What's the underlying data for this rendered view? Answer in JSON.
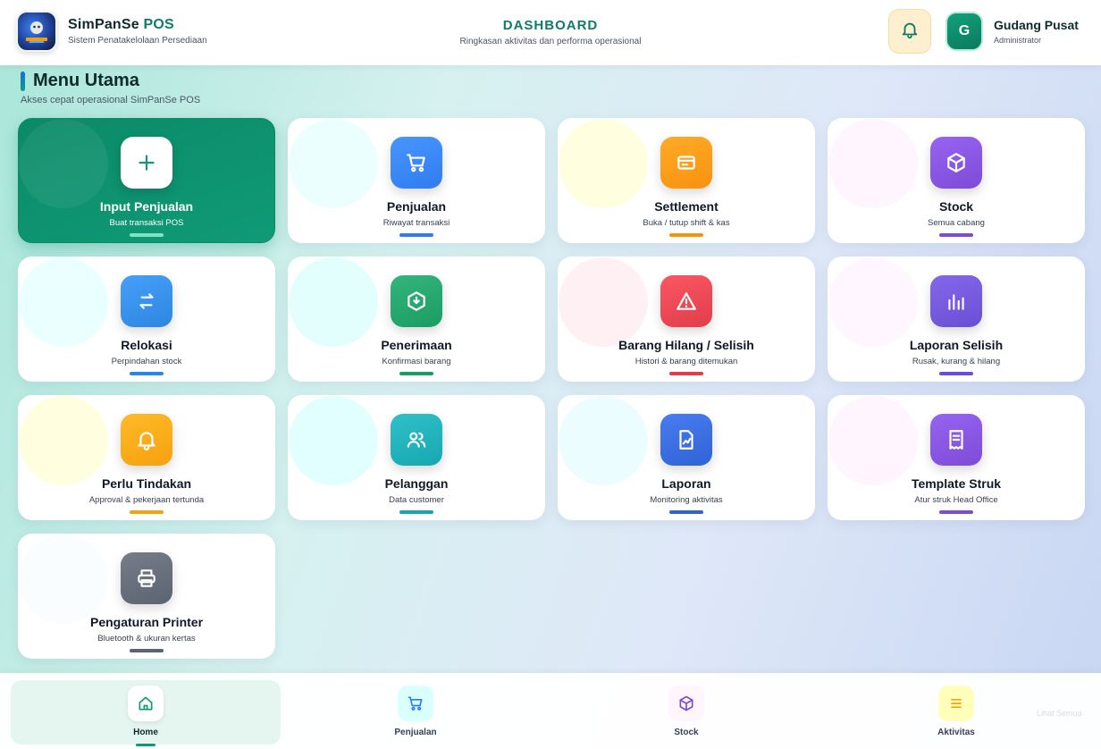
{
  "app": {
    "name_part1": "SimPanSe",
    "name_part2": "POS",
    "subtitle": "Sistem Penatakelolaan Persediaan"
  },
  "header": {
    "title": "DASHBOARD",
    "subtitle": "Ringkasan aktivitas dan performa operasional",
    "notification_icon": "bell-icon"
  },
  "user": {
    "initial": "G",
    "name": "Gudang Pusat",
    "role": "Administrator"
  },
  "section": {
    "title": "Menu Utama",
    "subtitle": "Akses cepat operasional SimPanSe POS"
  },
  "menu": [
    {
      "label": "Input Penjualan",
      "sub": "Buat transaksi POS",
      "icon": "plus-icon",
      "color": "#0e9a76",
      "primary": true
    },
    {
      "label": "Penjualan",
      "sub": "Riwayat transaksi",
      "icon": "cart-icon",
      "color": "#2f7cf0"
    },
    {
      "label": "Settlement",
      "sub": "Buka / tutup shift & kas",
      "icon": "cash-icon",
      "color": "#f7920f"
    },
    {
      "label": "Stock",
      "sub": "Semua cabang",
      "icon": "box-icon",
      "color": "#7e4bd8"
    },
    {
      "label": "Relokasi",
      "sub": "Perpindahan stock",
      "icon": "transfer-icon",
      "color": "#2d86e0"
    },
    {
      "label": "Penerimaan",
      "sub": "Konfirmasi barang",
      "icon": "receive-icon",
      "color": "#1a9c63"
    },
    {
      "label": "Barang Hilang / Selisih",
      "sub": "Histori & barang ditemukan",
      "icon": "warning-icon",
      "color": "#e23d4a"
    },
    {
      "label": "Laporan Selisih",
      "sub": "Rusak, kurang & hilang",
      "icon": "bar-chart-icon",
      "color": "#6a4fd3"
    },
    {
      "label": "Perlu Tindakan",
      "sub": "Approval & pekerjaan tertunda",
      "icon": "bell-icon",
      "color": "#f6a10f"
    },
    {
      "label": "Pelanggan",
      "sub": "Data customer",
      "icon": "users-icon",
      "color": "#17a7b0"
    },
    {
      "label": "Laporan",
      "sub": "Monitoring aktivitas",
      "icon": "report-icon",
      "color": "#2f63d6"
    },
    {
      "label": "Template Struk",
      "sub": "Atur struk Head Office",
      "icon": "receipt-icon",
      "color": "#7e4bd8"
    },
    {
      "label": "Pengaturan Printer",
      "sub": "Bluetooth & ukuran kertas",
      "icon": "printer-icon",
      "color": "#5b6470"
    }
  ],
  "bottom_nav": [
    {
      "label": "Home",
      "icon": "home-icon",
      "active": true,
      "color": "#0e9a76"
    },
    {
      "label": "Penjualan",
      "icon": "cart-icon",
      "active": false,
      "color": "#2f7cf0"
    },
    {
      "label": "Stock",
      "icon": "box-icon",
      "active": false,
      "color": "#7e4bd8"
    },
    {
      "label": "Aktivitas",
      "icon": "list-icon",
      "active": false,
      "color": "#f6a10f"
    }
  ],
  "faint_text": "Lihat Semua"
}
